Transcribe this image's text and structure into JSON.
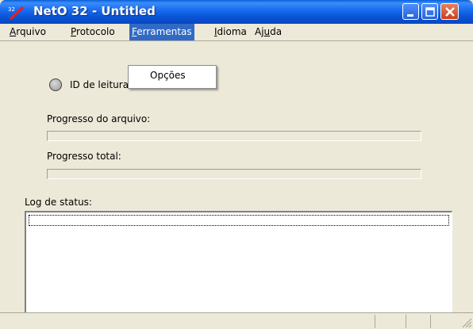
{
  "window": {
    "title": "NetO 32 - Untitled",
    "app_icon": "net-logo-icon",
    "controls": [
      "minimize-icon",
      "maximize-icon",
      "close-icon"
    ]
  },
  "menubar": {
    "items": [
      {
        "pre": "",
        "mnemonic": "A",
        "post": "rquivo"
      },
      {
        "pre": "",
        "mnemonic": "P",
        "post": "rotocolo"
      },
      {
        "pre": "",
        "mnemonic": "F",
        "post": "erramentas"
      },
      {
        "pre": "",
        "mnemonic": "I",
        "post": "dioma"
      },
      {
        "pre": "Aj",
        "mnemonic": "u",
        "post": "da"
      }
    ],
    "active_index": 2
  },
  "dropdown": {
    "items": [
      "Opções"
    ]
  },
  "content": {
    "read_id_label": "ID de leitura:",
    "file_progress_label": "Progresso do arquivo:",
    "file_progress_value": 0,
    "total_progress_label": "Progresso total:",
    "total_progress_value": 0,
    "log_label": "Log de status:",
    "log_lines": []
  },
  "colors": {
    "titlebar": "#0a55d6",
    "menu_highlight": "#316ac5",
    "window_bg": "#ece9d8"
  }
}
